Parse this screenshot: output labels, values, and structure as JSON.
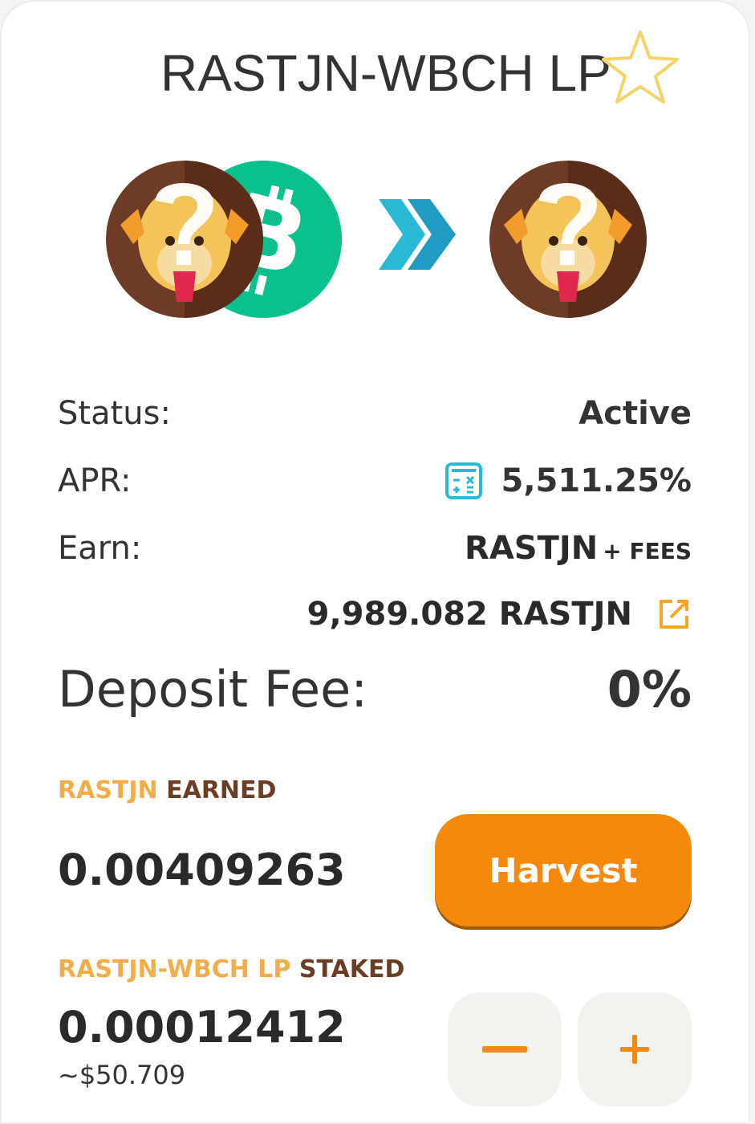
{
  "farm": {
    "title": "RASTJN-WBCH LP"
  },
  "details": {
    "status_label": "Status:",
    "status_value": "Active",
    "apr_label": "APR:",
    "apr_value": "5,511.25%",
    "earn_label": "Earn:",
    "earn_token": "RASTJN",
    "earn_fees": "+ FEES",
    "amount_value": "9,989.082 RASTJN",
    "deposit_label": "Deposit Fee:",
    "deposit_value": "0%"
  },
  "earned": {
    "token": "RASTJN",
    "word": "EARNED",
    "value": "0.00409263",
    "harvest_label": "Harvest"
  },
  "staked": {
    "token": "RASTJN-WBCH LP",
    "word": "STAKED",
    "value": "0.00012412",
    "usd": "~$50.709"
  },
  "icons": {
    "favorite": "star-outline-icon",
    "token_a": "rastjn-token-icon",
    "token_b": "bitcoin-cash-icon",
    "arrow": "double-chevron-right-icon",
    "calculator": "calculator-icon",
    "external": "external-link-icon",
    "minus": "minus-icon",
    "plus": "plus-icon"
  },
  "colors": {
    "accent_orange": "#f5890e",
    "label_gold": "#f2ad48",
    "label_brown": "#6b3d25",
    "bch_green": "#0ac18e",
    "teal": "#29b8d6"
  }
}
